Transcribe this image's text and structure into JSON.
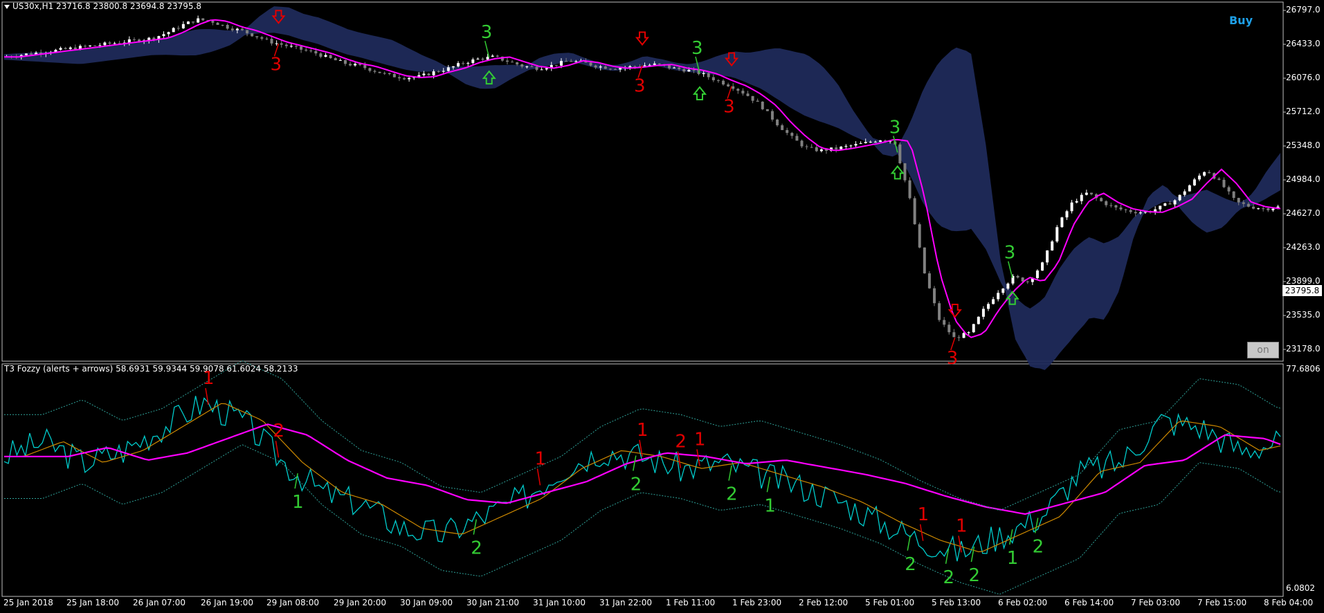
{
  "main_title": "US30x,H1  23716.8 23800.8 23694.8 23795.8",
  "indicator_title": "T3 Fozzy (alerts + arrows) 58.6931 59.9344 59.9078 61.6024 58.2133",
  "buy_label": "Buy",
  "on_button": "on",
  "current_price": "23795.8",
  "price_axis": [
    "26797.0",
    "26433.0",
    "26076.0",
    "25712.0",
    "25348.0",
    "24984.0",
    "24627.0",
    "24263.0",
    "23899.0",
    "23535.0",
    "23178.0"
  ],
  "indicator_axis": [
    "77.6806",
    "6.0802"
  ],
  "time_axis": [
    "25 Jan 2018",
    "25 Jan 18:00",
    "26 Jan 07:00",
    "26 Jan 19:00",
    "29 Jan 08:00",
    "29 Jan 20:00",
    "30 Jan 09:00",
    "30 Jan 21:00",
    "31 Jan 10:00",
    "31 Jan 22:00",
    "1 Feb 11:00",
    "1 Feb 23:00",
    "2 Feb 12:00",
    "5 Feb 01:00",
    "5 Feb 13:00",
    "6 Feb 02:00",
    "6 Feb 14:00",
    "7 Feb 03:00",
    "7 Feb 15:00",
    "8 Feb 04:00"
  ],
  "colors": {
    "bull": "#ffffff",
    "bear": "#808080",
    "cloud": "#1f2a5a",
    "ma": "#ff00ff",
    "sell": "#e00000",
    "buyc": "#33cc33",
    "fast": "#00cccc",
    "slow": "#cc8800"
  },
  "chart_data": {
    "type": "candlestick",
    "timeframe": "H1",
    "ylim": [
      23178,
      26797
    ],
    "close_path": [
      26300,
      26320,
      26340,
      26360,
      26380,
      26400,
      26420,
      26440,
      26460,
      26480,
      26500,
      26560,
      26640,
      26700,
      26680,
      26620,
      26580,
      26520,
      26460,
      26420,
      26380,
      26340,
      26280,
      26230,
      26200,
      26150,
      26100,
      26080,
      26090,
      26140,
      26180,
      26240,
      26280,
      26300,
      26250,
      26200,
      26180,
      26210,
      26260,
      26240,
      26200,
      26180,
      26190,
      26210,
      26220,
      26180,
      26160,
      26120,
      26050,
      25990,
      25900,
      25780,
      25600,
      25450,
      25330,
      25300,
      25320,
      25350,
      25380,
      25420,
      25400,
      24800,
      24000,
      23500,
      23300,
      23350,
      23600,
      23800,
      23950,
      23900,
      24100,
      24500,
      24750,
      24850,
      24750,
      24680,
      24650,
      24640,
      24700,
      24780,
      24950,
      25100,
      24950,
      24750,
      24700,
      24680,
      24700
    ],
    "signals": [
      {
        "type": "sell",
        "label": "3"
      },
      {
        "type": "buy",
        "label": "3"
      },
      {
        "type": "sell",
        "label": "3"
      },
      {
        "type": "buy",
        "label": "3"
      },
      {
        "type": "sell",
        "label": "3"
      },
      {
        "type": "buy",
        "label": "3"
      },
      {
        "type": "sell",
        "label": "3"
      },
      {
        "type": "buy",
        "label": "3"
      }
    ],
    "indicator_ylim": [
      6.0802,
      77.6806
    ],
    "indicator_labels": [
      "1",
      "2",
      "1",
      "2",
      "1",
      "2",
      "1",
      "2",
      "1",
      "2",
      "1",
      "2",
      "1",
      "2",
      "1",
      "2",
      "1",
      "2"
    ]
  }
}
